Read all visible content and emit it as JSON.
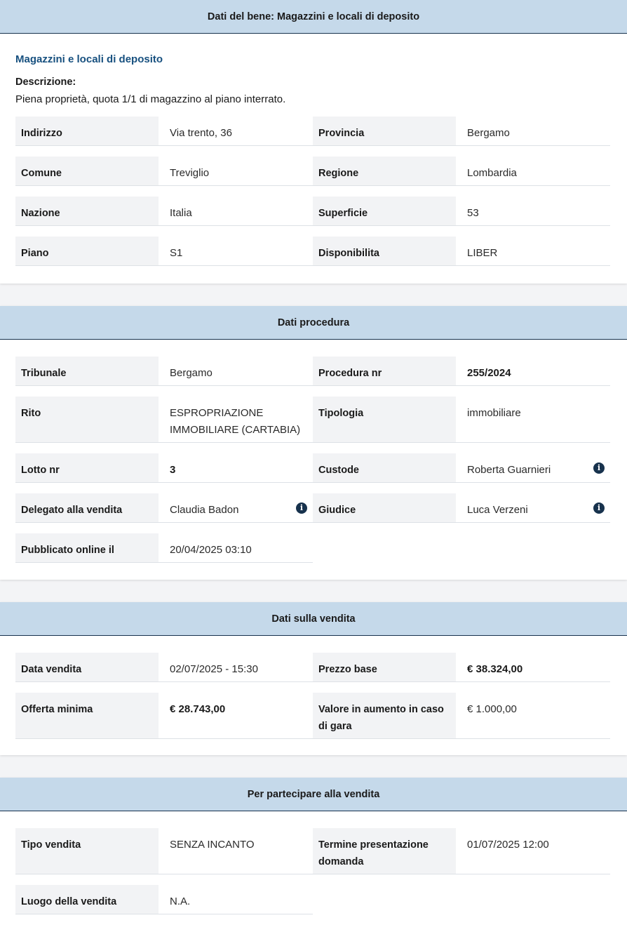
{
  "bene": {
    "header": "Dati del bene: Magazzini e locali di deposito",
    "subtitle": "Magazzini e locali di deposito",
    "desc_label": "Descrizione:",
    "desc_text": "Piena proprietà, quota 1/1 di magazzino al piano interrato.",
    "rows": [
      [
        {
          "label": "Indirizzo",
          "value": "Via trento, 36"
        },
        {
          "label": "Provincia",
          "value": "Bergamo"
        }
      ],
      [
        {
          "label": "Comune",
          "value": "Treviglio"
        },
        {
          "label": "Regione",
          "value": "Lombardia"
        }
      ],
      [
        {
          "label": "Nazione",
          "value": "Italia"
        },
        {
          "label": "Superficie",
          "value": "53"
        }
      ],
      [
        {
          "label": "Piano",
          "value": "S1"
        },
        {
          "label": "Disponibilita",
          "value": "LIBER"
        }
      ]
    ]
  },
  "procedura": {
    "header": "Dati procedura",
    "rows": [
      [
        {
          "label": "Tribunale",
          "value": "Bergamo"
        },
        {
          "label": "Procedura nr",
          "value": "255/2024"
        }
      ],
      [
        {
          "label": "Rito",
          "value": "ESPROPRIAZIONE IMMOBILIARE (CARTABIA)"
        },
        {
          "label": "Tipologia",
          "value": "immobiliare"
        }
      ],
      [
        {
          "label": "Lotto nr",
          "value": "3"
        },
        {
          "label": "Custode",
          "value": "Roberta Guarnieri"
        }
      ],
      [
        {
          "label": "Delegato alla vendita",
          "value": "Claudia Badon"
        },
        {
          "label": "Giudice",
          "value": "Luca Verzeni"
        }
      ],
      [
        {
          "label": "Pubblicato online il",
          "value": "20/04/2025 03:10"
        }
      ]
    ]
  },
  "vendita": {
    "header": "Dati sulla vendita",
    "rows": [
      [
        {
          "label": "Data vendita",
          "value": "02/07/2025 - 15:30"
        },
        {
          "label": "Prezzo base",
          "value": "€ 38.324,00"
        }
      ],
      [
        {
          "label": "Offerta minima",
          "value": "€ 28.743,00"
        },
        {
          "label": "Valore in aumento in caso di gara",
          "value": "€ 1.000,00"
        }
      ]
    ]
  },
  "partecipare": {
    "header": "Per partecipare alla vendita",
    "rows": [
      [
        {
          "label": "Tipo vendita",
          "value": "SENZA INCANTO"
        },
        {
          "label": "Termine presentazione domanda",
          "value": "01/07/2025 12:00"
        }
      ],
      [
        {
          "label": "Luogo della vendita",
          "value": "N.A."
        }
      ]
    ]
  },
  "icons": {
    "info": "info-icon"
  },
  "colors": {
    "header_bg": "#c5d9ea",
    "header_border": "#17324d",
    "label_bg": "#f2f3f5",
    "accent_text": "#17507f"
  }
}
